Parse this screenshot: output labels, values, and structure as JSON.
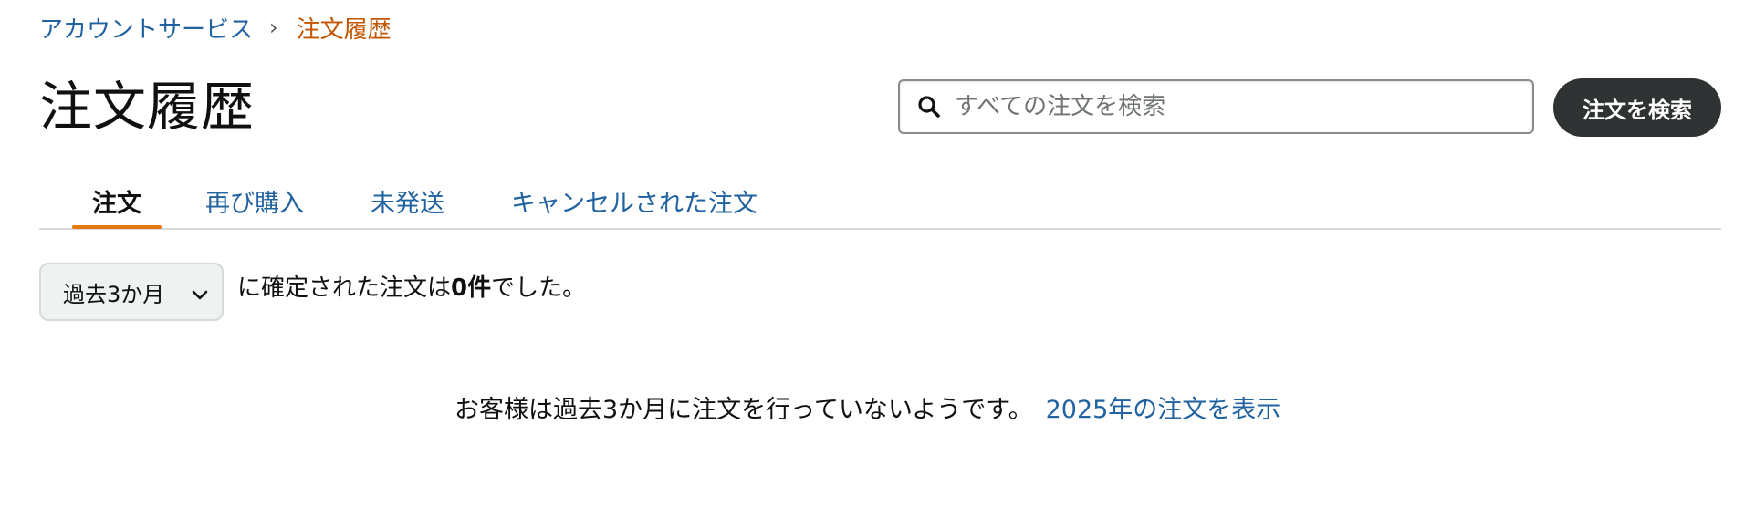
{
  "breadcrumb": {
    "parent": "アカウントサービス",
    "separator": "›",
    "current": "注文履歴"
  },
  "page_title": "注文履歴",
  "search": {
    "placeholder": "すべての注文を検索",
    "value": "",
    "button_label": "注文を検索",
    "icon": "search-icon"
  },
  "tabs": [
    {
      "label": "注文",
      "active": true
    },
    {
      "label": "再び購入",
      "active": false
    },
    {
      "label": "未発送",
      "active": false
    },
    {
      "label": "キャンセルされた注文",
      "active": false
    }
  ],
  "filter": {
    "selected": "過去3か月",
    "icon": "chevron-down-icon"
  },
  "summary": {
    "prefix": "に確定された注文は",
    "count": "0件",
    "suffix": "でした。"
  },
  "empty_state": {
    "message": "お客様は過去3か月に注文を行っていないようです。",
    "link": "2025年の注文を表示"
  },
  "colors": {
    "link": "#2162a1",
    "breadcrumb_current": "#c45500",
    "tab_underline": "#e47911",
    "search_button_bg": "#303333"
  }
}
